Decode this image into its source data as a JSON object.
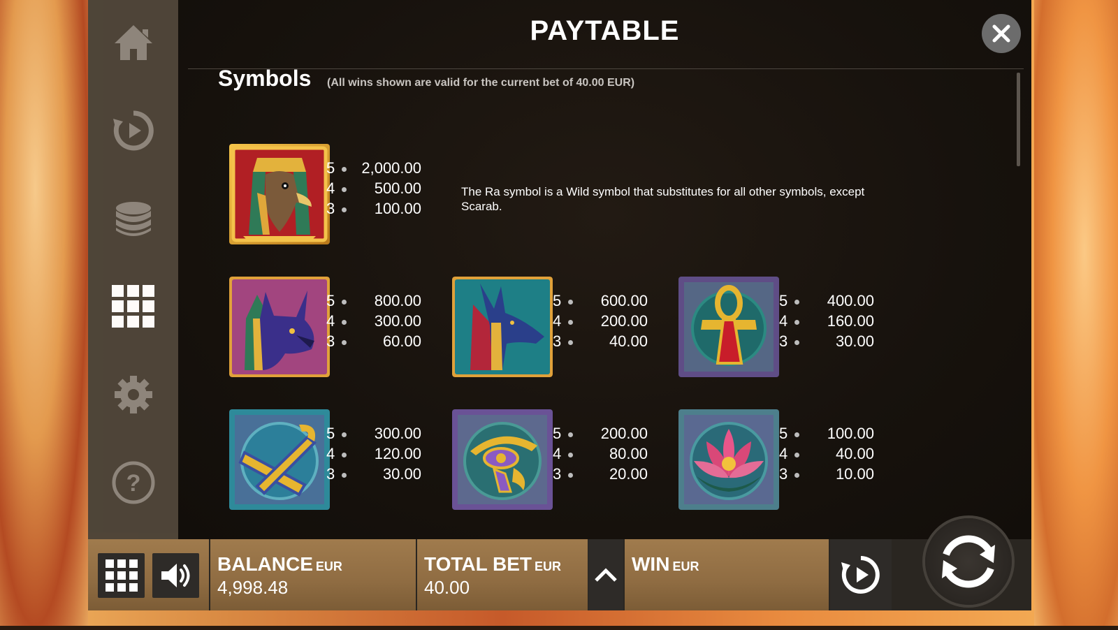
{
  "title": "PAYTABLE",
  "section": {
    "heading": "Symbols",
    "note": "(All wins shown are valid for the current bet of 40.00 EUR)"
  },
  "wild_description": "The Ra symbol is a Wild symbol that substitutes for all other symbols, except Scarab.",
  "symbols": [
    {
      "name": "ra",
      "payouts": [
        {
          "count": "5",
          "value": "2,000.00"
        },
        {
          "count": "4",
          "value": "500.00"
        },
        {
          "count": "3",
          "value": "100.00"
        }
      ]
    },
    {
      "name": "bastet",
      "payouts": [
        {
          "count": "5",
          "value": "800.00"
        },
        {
          "count": "4",
          "value": "300.00"
        },
        {
          "count": "3",
          "value": "60.00"
        }
      ]
    },
    {
      "name": "anubis",
      "payouts": [
        {
          "count": "5",
          "value": "600.00"
        },
        {
          "count": "4",
          "value": "200.00"
        },
        {
          "count": "3",
          "value": "40.00"
        }
      ]
    },
    {
      "name": "ankh",
      "payouts": [
        {
          "count": "5",
          "value": "400.00"
        },
        {
          "count": "4",
          "value": "160.00"
        },
        {
          "count": "3",
          "value": "30.00"
        }
      ]
    },
    {
      "name": "crook-flail",
      "payouts": [
        {
          "count": "5",
          "value": "300.00"
        },
        {
          "count": "4",
          "value": "120.00"
        },
        {
          "count": "3",
          "value": "30.00"
        }
      ]
    },
    {
      "name": "eye-of-horus",
      "payouts": [
        {
          "count": "5",
          "value": "200.00"
        },
        {
          "count": "4",
          "value": "80.00"
        },
        {
          "count": "3",
          "value": "20.00"
        }
      ]
    },
    {
      "name": "lotus",
      "payouts": [
        {
          "count": "5",
          "value": "100.00"
        },
        {
          "count": "4",
          "value": "40.00"
        },
        {
          "count": "3",
          "value": "10.00"
        }
      ]
    }
  ],
  "sidebar": [
    "home-icon",
    "replay-icon",
    "coins-icon",
    "paytable-grid-icon",
    "settings-gear-icon",
    "help-icon"
  ],
  "bottom": {
    "balance_label": "BALANCE",
    "balance_currency": "EUR",
    "balance_value": "4,998.48",
    "bet_label": "TOTAL BET",
    "bet_currency": "EUR",
    "bet_value": "40.00",
    "win_label": "WIN",
    "win_currency": "EUR",
    "win_value": ""
  },
  "colors": {
    "panel": "#17120d",
    "sidebar": "#4a4238",
    "bar_gold": "#8f6c42",
    "close_button": "#6c6c6c"
  }
}
